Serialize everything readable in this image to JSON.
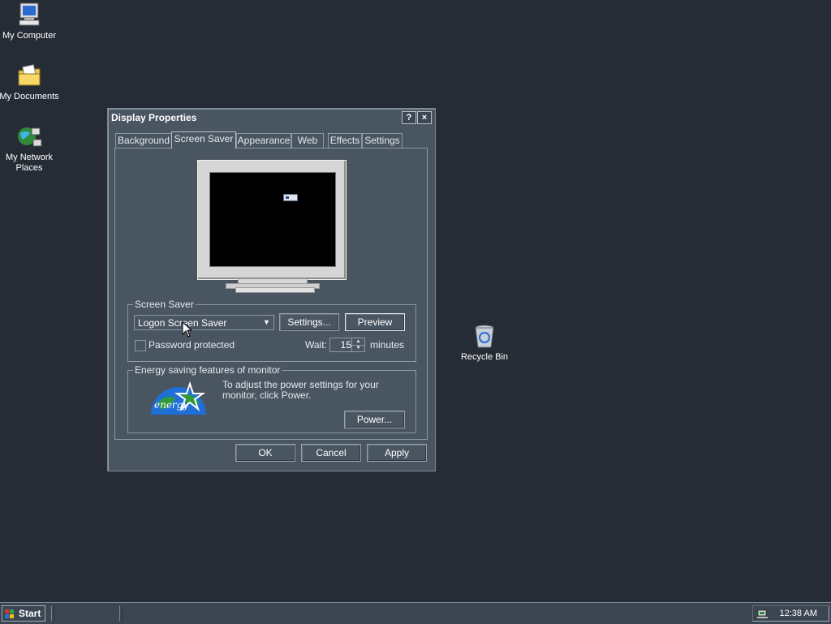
{
  "desktop": {
    "icons": [
      {
        "label": "My Computer"
      },
      {
        "label": "My Documents"
      },
      {
        "label": "My Network Places"
      },
      {
        "label": "Recycle Bin"
      }
    ]
  },
  "window": {
    "title": "Display Properties",
    "help_glyph": "?",
    "close_glyph": "×",
    "tabs": [
      "Background",
      "Screen Saver",
      "Appearance",
      "Web",
      "Effects",
      "Settings"
    ],
    "active_tab": "Screen Saver",
    "screensaver_group": {
      "label": "Screen Saver",
      "selected": "Logon Screen Saver",
      "settings_button": "Settings...",
      "preview_button": "Preview",
      "password_label": "Password protected",
      "password_checked": false,
      "wait_label": "Wait:",
      "wait_value": "15",
      "wait_unit": "minutes"
    },
    "energy_group": {
      "label": "Energy saving features of monitor",
      "text": "To adjust the power settings for your monitor, click Power.",
      "power_button": "Power...",
      "logo_text": "energy"
    },
    "buttons": {
      "ok": "OK",
      "cancel": "Cancel",
      "apply": "Apply"
    }
  },
  "taskbar": {
    "start_label": "Start",
    "clock": "12:38 AM"
  }
}
